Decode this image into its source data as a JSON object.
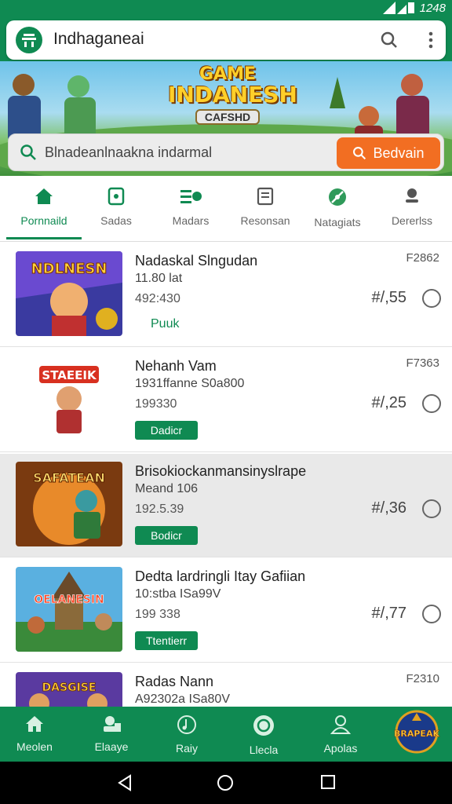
{
  "status_bar": {
    "time": "1248"
  },
  "app_bar": {
    "title": "Indhaganeai"
  },
  "banner": {
    "title_line1": "GAME",
    "title_line2": "INDANESH",
    "subtitle": "CAFSHD"
  },
  "search": {
    "text": "Blnadeanlnaakna indarmal",
    "button_label": "Bedvain"
  },
  "tabs": [
    {
      "label": "Pornnaild",
      "icon": "home-icon"
    },
    {
      "label": "Sadas",
      "icon": "tablet-icon"
    },
    {
      "label": "Madars",
      "icon": "menu-settings-icon"
    },
    {
      "label": "Resonsan",
      "icon": "document-icon"
    },
    {
      "label": "Natagiats",
      "icon": "compass-icon"
    },
    {
      "label": "Dererlss",
      "icon": "person-icon"
    }
  ],
  "items": [
    {
      "title": "Nadaskal Slngudan",
      "subtitle": "11.80 lat",
      "count": "492:430",
      "code": "F2862",
      "price": "#/,55",
      "action": "Puuk",
      "action_type": "link",
      "thumb_caption": "NDLNESN"
    },
    {
      "title": "Nehanh Vam",
      "subtitle": "1931ffanne S0a800",
      "count": "199330",
      "code": "F7363",
      "price": "#/,25",
      "action": "Dadicr",
      "action_type": "button",
      "thumb_caption": "STAEEIK"
    },
    {
      "title": "Brisokiockanmansinyslrape",
      "subtitle": "Meand 106",
      "count": "192.5.39",
      "code": "",
      "price": "#/,36",
      "action": "Bodicr",
      "action_type": "button",
      "thumb_caption": "SAFATEAN"
    },
    {
      "title": "Dedta lardringli Itay Gafiian",
      "subtitle": "10:stba ISa99V",
      "count": "199 338",
      "code": "",
      "price": "#/,77",
      "action": "Ttentierr",
      "action_type": "button",
      "thumb_caption": "OELANESIN"
    },
    {
      "title": "Radas Nann",
      "subtitle": "A92302a ISa80V",
      "count": "",
      "code": "F2310",
      "price": "",
      "action": "",
      "action_type": "none",
      "thumb_caption": "DASGISE"
    }
  ],
  "bottom_nav": [
    {
      "label": "Meolen",
      "icon": "home-icon"
    },
    {
      "label": "Elaaye",
      "icon": "person-card-icon"
    },
    {
      "label": "Raiy",
      "icon": "music-disc-icon"
    },
    {
      "label": "Llecla",
      "icon": "badge-icon"
    },
    {
      "label": "Apolas",
      "icon": "user-icon"
    }
  ],
  "bottom_logo": "BRAPEAK"
}
